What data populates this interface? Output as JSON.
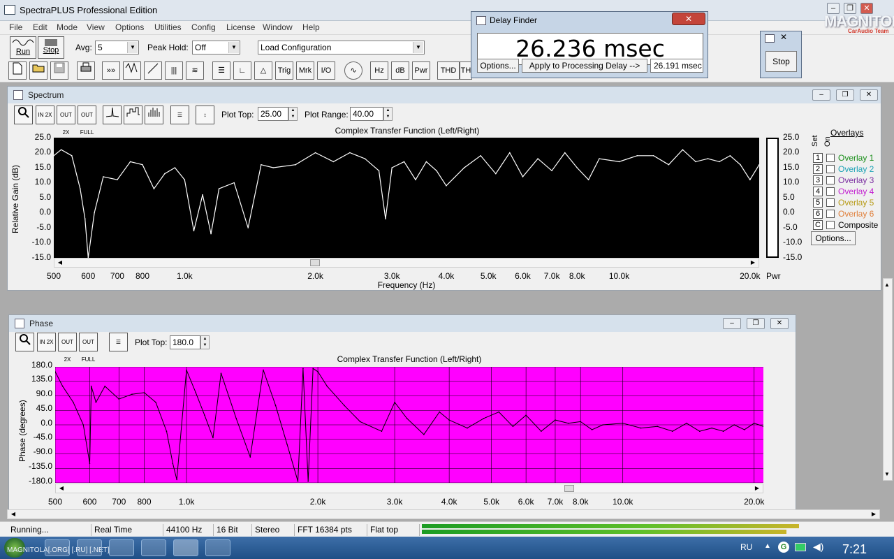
{
  "app": {
    "title": "SpectraPLUS Professional Edition"
  },
  "menu": [
    "File",
    "Edit",
    "Mode",
    "View",
    "Options",
    "Utilities",
    "Config",
    "License",
    "Window",
    "Help"
  ],
  "toolbar": {
    "run_label": "Run",
    "stop_label": "Stop",
    "avg_label": "Avg:",
    "avg_value": "5",
    "peak_hold_label": "Peak Hold:",
    "peak_hold_value": "Off",
    "config_value": "Load Configuration",
    "text_buttons": [
      "Trig",
      "Mrk",
      "I/O",
      "Hz",
      "dB",
      "Pwr",
      "THD",
      "TH"
    ]
  },
  "delay_finder": {
    "title": "Delay Finder",
    "value": "26.236 msec",
    "options_label": "Options...",
    "apply_label": "Apply to Processing Delay -->",
    "delay_value": "26.191 msec"
  },
  "stop_window": {
    "stop_label": "Stop"
  },
  "watermark": {
    "text": "MAGNITOLA",
    "sub": "CarAudio Team"
  },
  "spectrum": {
    "window_title": "Spectrum",
    "plot_top_label": "Plot Top:",
    "plot_top_value": "25.00",
    "plot_range_label": "Plot Range:",
    "plot_range_value": "40.00",
    "chart_title": "Complex Transfer Function (Left/Right)",
    "ylabel": "Relative Gain (dB)",
    "xlabel": "Frequency (Hz)",
    "yticks": [
      "25.0",
      "20.0",
      "15.0",
      "10.0",
      "5.0",
      "0.0",
      "-5.0",
      "-10.0",
      "-15.0"
    ],
    "xticks": [
      "500",
      "600",
      "700",
      "800",
      "1.0k",
      "2.0k",
      "3.0k",
      "4.0k",
      "5.0k",
      "6.0k",
      "7.0k",
      "8.0k",
      "10.0k",
      "20.0k"
    ],
    "pwr_label": "Pwr",
    "overlays": {
      "title": "Overlays",
      "set_label": "Set",
      "on_label": "On",
      "items": [
        {
          "num": "1",
          "name": "Overlay 1",
          "color": "#1a8f1a"
        },
        {
          "num": "2",
          "name": "Overlay 2",
          "color": "#1ea3b5"
        },
        {
          "num": "3",
          "name": "Overlay 3",
          "color": "#7b2fa0"
        },
        {
          "num": "4",
          "name": "Overlay 4",
          "color": "#c21fd0"
        },
        {
          "num": "5",
          "name": "Overlay 5",
          "color": "#b79a14"
        },
        {
          "num": "6",
          "name": "Overlay 6",
          "color": "#e07f3a"
        },
        {
          "num": "C",
          "name": "Composite",
          "color": "#000000"
        }
      ],
      "options_label": "Options..."
    }
  },
  "phase": {
    "window_title": "Phase",
    "plot_top_label": "Plot Top:",
    "plot_top_value": "180.0",
    "chart_title": "Complex Transfer Function (Left/Right)",
    "ylabel": "Phase (degrees)",
    "yticks": [
      "180.0",
      "135.0",
      "90.0",
      "45.0",
      "0.0",
      "-45.0",
      "-90.0",
      "-135.0",
      "-180.0"
    ],
    "xticks": [
      "500",
      "600",
      "700",
      "800",
      "1.0k",
      "2.0k",
      "3.0k",
      "4.0k",
      "5.0k",
      "6.0k",
      "7.0k",
      "8.0k",
      "10.0k",
      "20.0k"
    ],
    "bg_color": "#ff00ff"
  },
  "status": {
    "running": "Running...",
    "mode": "Real Time",
    "rate": "44100 Hz",
    "bits": "16 Bit",
    "channels": "Stereo",
    "fft": "FFT 16384 pts",
    "window": "Flat top"
  },
  "taskbar": {
    "lang": "RU",
    "time": "7:21",
    "watermark": "MAGNITOLA[.ORG] [.RU] [.NET]"
  },
  "chart_data": [
    {
      "type": "line",
      "title": "Complex Transfer Function (Left/Right)",
      "xlabel": "Frequency (Hz)",
      "ylabel": "Relative Gain (dB)",
      "xscale": "log",
      "xlim": [
        500,
        21000
      ],
      "ylim": [
        -15,
        25
      ],
      "grid": false,
      "color": "#ffffff",
      "background": "#000000",
      "x": [
        500,
        520,
        550,
        575,
        590,
        600,
        620,
        650,
        700,
        750,
        800,
        850,
        900,
        950,
        1000,
        1050,
        1100,
        1150,
        1200,
        1300,
        1400,
        1500,
        1600,
        1800,
        2000,
        2200,
        2400,
        2600,
        2800,
        2900,
        3000,
        3200,
        3400,
        3600,
        3800,
        4000,
        4400,
        4800,
        5200,
        5600,
        6000,
        6500,
        7000,
        7500,
        8000,
        8500,
        9000,
        10000,
        11000,
        12000,
        13000,
        14000,
        15000,
        16000,
        17000,
        18000,
        19000,
        20000,
        21000
      ],
      "values": [
        19,
        21,
        19,
        8,
        -2,
        -15,
        0,
        12,
        11,
        17,
        16,
        8,
        13,
        15,
        11,
        -6,
        6,
        -7,
        8,
        10,
        -5,
        16,
        15,
        16,
        20,
        17,
        20,
        18,
        14,
        -2,
        15,
        17,
        11,
        17,
        14,
        9,
        15,
        19,
        13,
        20,
        12,
        18,
        14,
        20,
        15,
        11,
        18,
        17,
        19,
        19,
        16,
        21,
        17,
        18,
        17,
        19,
        16,
        11,
        16
      ]
    },
    {
      "type": "line",
      "title": "Complex Transfer Function (Left/Right)",
      "ylabel": "Phase (degrees)",
      "xscale": "log",
      "xlim": [
        500,
        21000
      ],
      "ylim": [
        -180,
        180
      ],
      "grid": true,
      "color": "#000000",
      "background": "#ff00ff",
      "x": [
        500,
        520,
        550,
        580,
        600,
        605,
        620,
        650,
        700,
        750,
        800,
        850,
        900,
        930,
        950,
        1000,
        1050,
        1100,
        1150,
        1200,
        1300,
        1400,
        1500,
        1600,
        1700,
        1800,
        1850,
        1900,
        1950,
        2000,
        2100,
        2300,
        2500,
        2800,
        3000,
        3200,
        3500,
        3800,
        4000,
        4400,
        4800,
        5200,
        5600,
        6000,
        6500,
        7000,
        7500,
        8000,
        8500,
        9000,
        10000,
        11000,
        12000,
        13000,
        14000,
        15000,
        16000,
        17000,
        18000,
        19000,
        20000,
        21000
      ],
      "values": [
        165,
        120,
        70,
        0,
        -120,
        120,
        70,
        120,
        80,
        95,
        100,
        70,
        -20,
        -120,
        -170,
        170,
        100,
        30,
        -40,
        160,
        20,
        -100,
        170,
        60,
        -60,
        -175,
        175,
        -175,
        175,
        165,
        120,
        60,
        10,
        -20,
        70,
        20,
        -30,
        40,
        15,
        -10,
        20,
        40,
        -5,
        30,
        -20,
        15,
        5,
        10,
        -15,
        0,
        5,
        -10,
        -5,
        -20,
        5,
        -20,
        -10,
        -20,
        0,
        -15,
        5,
        -5
      ]
    }
  ]
}
